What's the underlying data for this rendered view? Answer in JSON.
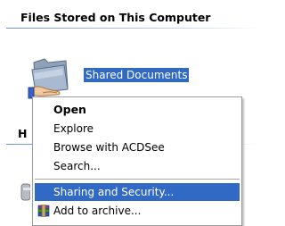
{
  "sections": {
    "files_stored_title": "Files Stored on This Computer",
    "hidden_section_title_partial": "H"
  },
  "shared_folder": {
    "label": "Shared Documents",
    "icon": "shared-folder-icon"
  },
  "context_menu": {
    "items": [
      {
        "label": "Open",
        "bold": true
      },
      {
        "label": "Explore"
      },
      {
        "label": "Browse with ACDSee"
      },
      {
        "label": "Search..."
      },
      {
        "label": "Sharing and Security...",
        "highlighted": true
      },
      {
        "label": "Add to archive...",
        "icon": "winrar-archive-icon"
      }
    ]
  },
  "colors": {
    "selection": "#316ac5",
    "header_rule": "#6f90d6"
  }
}
